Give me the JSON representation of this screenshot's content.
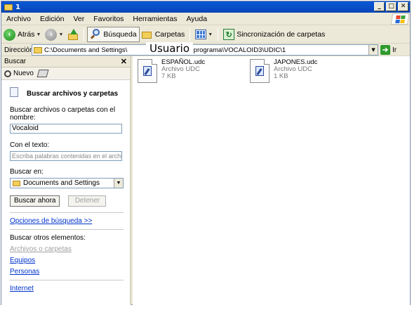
{
  "window": {
    "title": "1"
  },
  "menubar": {
    "items": [
      "Archivo",
      "Edición",
      "Ver",
      "Favoritos",
      "Herramientas",
      "Ayuda"
    ]
  },
  "toolbar": {
    "back_label": "Atrás",
    "search_label": "Búsqueda",
    "folders_label": "Carpetas",
    "sync_label": "Sincronización de carpetas"
  },
  "address": {
    "label": "Dirección",
    "path_prefix": "C:\\Documents and Settings\\",
    "overlay": "Usuario",
    "path_suffix": "Datos de programa\\VOCALOID3\\UDIC\\1",
    "go_label": "Ir"
  },
  "search_pane": {
    "header": "Buscar",
    "new_label": "Nuevo",
    "title": "Buscar archivos y carpetas",
    "name_label": "Buscar archivos o carpetas con el nombre:",
    "name_value": "Vocaloid",
    "text_label": "Con el texto:",
    "text_placeholder": "Escriba palabras contenidas en el archivo.",
    "look_in_label": "Buscar en:",
    "look_in_value": "Documents and Settings",
    "search_now": "Buscar ahora",
    "stop": "Detener",
    "options_link": "Opciones de búsqueda  >>",
    "other_label": "Buscar otros elementos:",
    "other_links": [
      "Archivos o carpetas",
      "Equipos",
      "Personas"
    ],
    "internet_link": "Internet"
  },
  "files": [
    {
      "name": "ESPAÑOL.udc",
      "type": "Archivo UDC",
      "size": "7 KB"
    },
    {
      "name": "JAPONES.udc",
      "type": "Archivo UDC",
      "size": "1 KB"
    }
  ]
}
